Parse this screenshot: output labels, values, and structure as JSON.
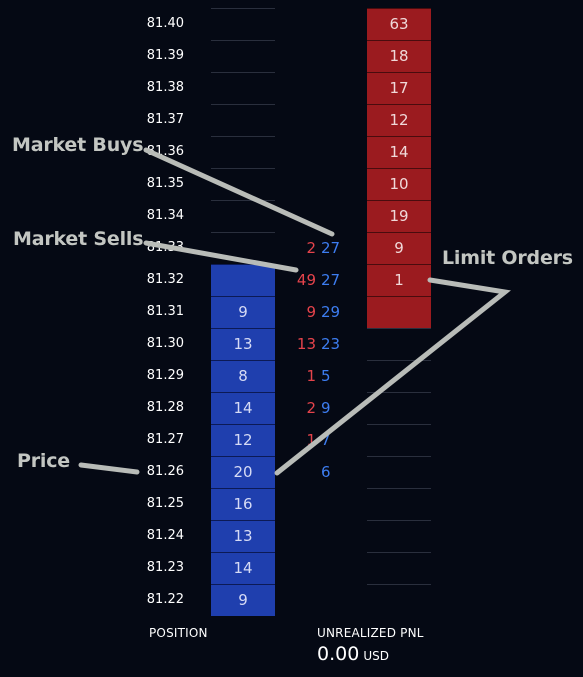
{
  "ladder": {
    "rows": [
      {
        "price": "81.40",
        "bid": "",
        "ask": "63",
        "market_sells": "",
        "market_buys": ""
      },
      {
        "price": "81.39",
        "bid": "",
        "ask": "18",
        "market_sells": "",
        "market_buys": ""
      },
      {
        "price": "81.38",
        "bid": "",
        "ask": "17",
        "market_sells": "",
        "market_buys": ""
      },
      {
        "price": "81.37",
        "bid": "",
        "ask": "12",
        "market_sells": "",
        "market_buys": ""
      },
      {
        "price": "81.36",
        "bid": "",
        "ask": "14",
        "market_sells": "",
        "market_buys": ""
      },
      {
        "price": "81.35",
        "bid": "",
        "ask": "10",
        "market_sells": "",
        "market_buys": ""
      },
      {
        "price": "81.34",
        "bid": "",
        "ask": "19",
        "market_sells": "",
        "market_buys": ""
      },
      {
        "price": "81.33",
        "bid": "",
        "ask": "9",
        "market_sells": "2",
        "market_buys": "27"
      },
      {
        "price": "81.32",
        "bid": "",
        "ask": "1",
        "market_sells": "49",
        "market_buys": "27"
      },
      {
        "price": "81.31",
        "bid": "9",
        "ask": "",
        "market_sells": "9",
        "market_buys": "29"
      },
      {
        "price": "81.30",
        "bid": "13",
        "ask": "",
        "market_sells": "13",
        "market_buys": "23"
      },
      {
        "price": "81.29",
        "bid": "8",
        "ask": "",
        "market_sells": "1",
        "market_buys": "5"
      },
      {
        "price": "81.28",
        "bid": "14",
        "ask": "",
        "market_sells": "2",
        "market_buys": "9"
      },
      {
        "price": "81.27",
        "bid": "12",
        "ask": "",
        "market_sells": "1",
        "market_buys": "7"
      },
      {
        "price": "81.26",
        "bid": "20",
        "ask": "",
        "market_sells": "",
        "market_buys": "6"
      },
      {
        "price": "81.25",
        "bid": "16",
        "ask": "",
        "market_sells": "",
        "market_buys": ""
      },
      {
        "price": "81.24",
        "bid": "13",
        "ask": "",
        "market_sells": "",
        "market_buys": ""
      },
      {
        "price": "81.23",
        "bid": "14",
        "ask": "",
        "market_sells": "",
        "market_buys": ""
      },
      {
        "price": "81.22",
        "bid": "9",
        "ask": "",
        "market_sells": "",
        "market_buys": ""
      }
    ],
    "filled_bid_rows": [
      8,
      9,
      10,
      11,
      12,
      13,
      14,
      15,
      16,
      17,
      18
    ],
    "filled_ask_rows": [
      0,
      1,
      2,
      3,
      4,
      5,
      6,
      7,
      8,
      9
    ]
  },
  "callouts": {
    "market_buys": "Market Buys",
    "market_sells": "Market Sells",
    "limit_orders": "Limit Orders",
    "price": "Price"
  },
  "footer": {
    "position_label": "POSITION",
    "pnl_label": "UNREALIZED PNL",
    "pnl_value": "0.00",
    "pnl_unit": "USD"
  },
  "colors": {
    "background": "#050914",
    "bid_fill": "#1f3fae",
    "ask_fill": "#9b1b1f",
    "sell_text": "#e5434b",
    "buy_text": "#3d7df0",
    "callout": "#c3c6c2"
  }
}
